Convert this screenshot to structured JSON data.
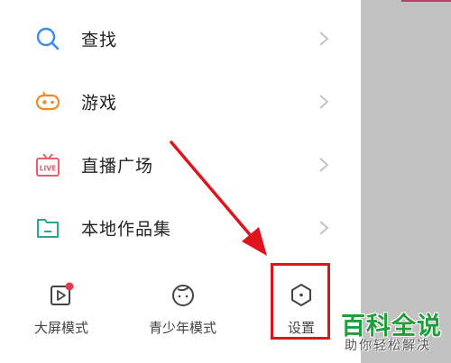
{
  "menu": {
    "items": [
      {
        "label": "查找",
        "icon": "search-icon",
        "color": "#3a8ee6"
      },
      {
        "label": "游戏",
        "icon": "gamepad-icon",
        "color": "#f08a24"
      },
      {
        "label": "直播广场",
        "icon": "live-tv-icon",
        "color": "#f05a6a",
        "badge": "LIVE"
      },
      {
        "label": "本地作品集",
        "icon": "folder-icon",
        "color": "#2aa58f"
      }
    ]
  },
  "bottom": {
    "big_screen_label": "大屏模式",
    "teen_mode_label": "青少年模式",
    "settings_label": "设置",
    "notification_dot_color": "#e8384a"
  },
  "annotation": {
    "highlight_color": "#e0141c"
  },
  "watermark": {
    "title": "百科全说",
    "subtitle": "助你轻松解决",
    "color": "#1f9e3c"
  }
}
